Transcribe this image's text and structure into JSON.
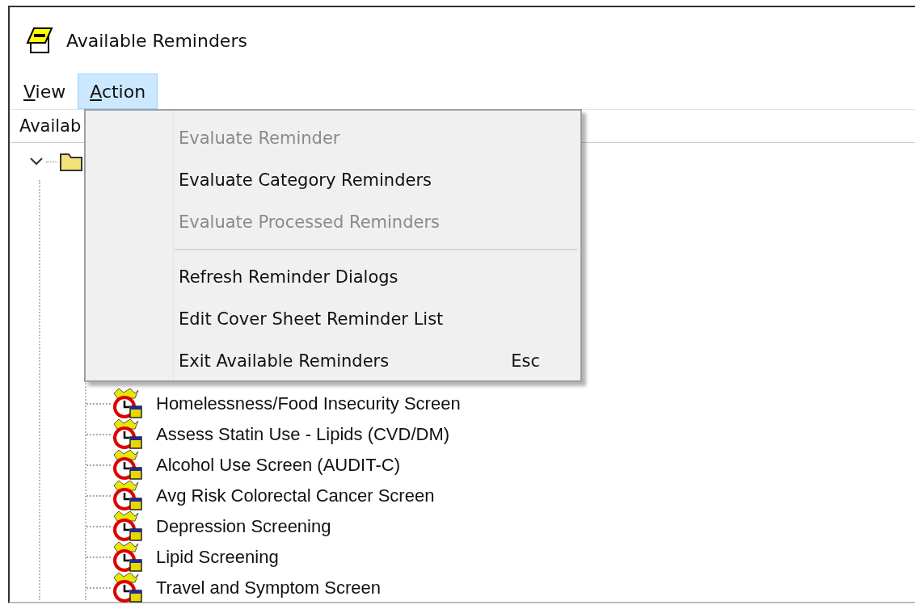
{
  "window": {
    "title": "Available Reminders"
  },
  "menu_bar": [
    {
      "label": "View",
      "selected": false
    },
    {
      "label": "Action",
      "selected": true
    }
  ],
  "tree_header": {
    "label": "Availab"
  },
  "tree": {
    "expanded": true,
    "children": [
      {
        "label": "Homelessness/Food Insecurity Screen"
      },
      {
        "label": "Assess Statin Use - Lipids (CVD/DM)"
      },
      {
        "label": "Alcohol Use Screen (AUDIT-C)"
      },
      {
        "label": "Avg Risk Colorectal Cancer Screen"
      },
      {
        "label": "Depression Screening"
      },
      {
        "label": "Lipid Screening"
      },
      {
        "label": "Travel and Symptom Screen"
      }
    ]
  },
  "action_menu": {
    "items": [
      {
        "kind": "item",
        "label": "Evaluate Reminder",
        "disabled": true
      },
      {
        "kind": "item",
        "label": "Evaluate Category Reminders",
        "disabled": false
      },
      {
        "kind": "item",
        "label": "Evaluate Processed Reminders",
        "disabled": true
      },
      {
        "kind": "separator"
      },
      {
        "kind": "item",
        "label": "Refresh Reminder Dialogs",
        "disabled": false
      },
      {
        "kind": "item",
        "label": "Edit Cover Sheet Reminder List",
        "disabled": false
      },
      {
        "kind": "item",
        "label": "Exit Available Reminders",
        "shortcut": "Esc",
        "disabled": false
      }
    ]
  }
}
